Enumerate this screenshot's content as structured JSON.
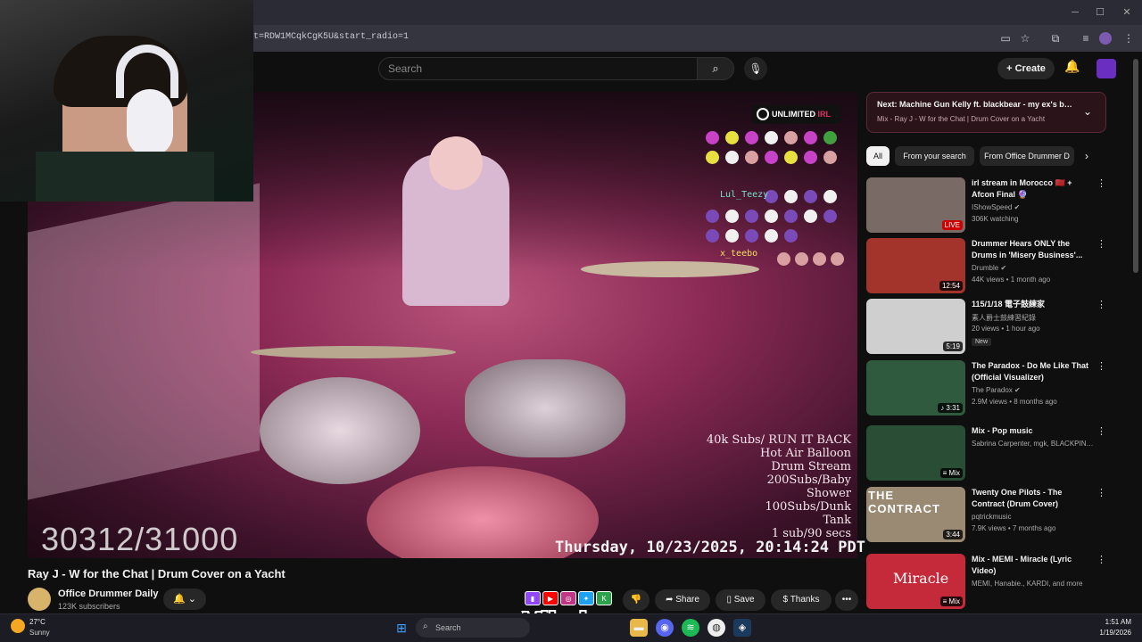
{
  "browser": {
    "url": "t=RDW1MCqkCgK5U&start_radio=1",
    "controls": {
      "minimize": "─",
      "maximize": "☐",
      "close": "✕"
    }
  },
  "header": {
    "search_placeholder": "Search",
    "create_label": "Create"
  },
  "video": {
    "counter": "30312/31000",
    "timestamp": "Thursday, 10/23/2025, 20:14:24 PDT",
    "brand": {
      "prefix": "UNLIMITED",
      "suffix": "IRL"
    },
    "goals": [
      "40k Subs/ RUN IT BACK",
      "Hot Air Balloon",
      "Drum Stream",
      "200Subs/Baby",
      "Shower",
      "100Subs/Dunk",
      "Tank",
      "1 sub/90 secs"
    ],
    "chat": [
      {
        "name": "Lul_Teezy"
      },
      {
        "name": "x_teebo"
      }
    ],
    "title": "Ray J - W for the Chat | Drum Cover on a Yacht",
    "channel": {
      "name": "Office Drummer Daily",
      "subs": "123K subscribers"
    },
    "actions": {
      "share": "Share",
      "save": "Save",
      "thanks": "Thanks",
      "more": "•••"
    }
  },
  "sidebar": {
    "next": {
      "line1": "Next: Machine Gun Kelly ft. blackbear - my ex's best...",
      "line2": "Mix - Ray J - W for the Chat | Drum Cover on a Yacht"
    },
    "chips": [
      "All",
      "From your search",
      "From Office Drummer D"
    ],
    "recommendations": [
      {
        "title": "irl stream in Morocco 🇲🇦 + Afcon Final 🔮",
        "channel": "IShowSpeed ✔",
        "meta": "306K watching",
        "badge": "LIVE",
        "thumb_bg": "#7a6a66"
      },
      {
        "title": "Drummer Hears ONLY the Drums in 'Misery Business'...",
        "channel": "Drumble ✔",
        "meta": "44K views • 1 month ago",
        "badge": "12:54",
        "thumb_bg": "#a2342c"
      },
      {
        "title": "115/1/18 電子鼓練家",
        "channel": "素人爵士鼓練習紀錄",
        "meta": "20 views • 1 hour ago",
        "badge": "5:19",
        "thumb_bg": "#cfcfcf",
        "new": "New"
      },
      {
        "title": "The Paradox - Do Me Like That (Official Visualizer)",
        "channel": "The Paradox ✔",
        "meta": "2.9M views • 8 months ago",
        "badge": "♪ 3:31",
        "thumb_bg": "#2f5a3d"
      },
      {
        "title": "Mix - Pop music",
        "channel": "Sabrina Carpenter, mgk, BLACKPINK, and more",
        "meta": "",
        "badge": "≡ Mix",
        "thumb_bg": "#2a4d36"
      },
      {
        "title": "Twenty One Pilots - The Contract (Drum Cover)",
        "channel": "pqtrickmusic",
        "meta": "7.9K views • 7 months ago",
        "badge": "3:44",
        "thumb_bg": "#9a8a74"
      },
      {
        "title": "Mix - MEMI - Miracle (Lyric Video)",
        "channel": "MEMI, Hanabie., KARDI, and more",
        "meta": "",
        "badge": "≡ Mix",
        "thumb_bg": "#c42a3a"
      }
    ],
    "contract_thumb_text": "THE CONTRACT",
    "miracle_thumb_text": "Miracle"
  },
  "taskbar": {
    "weather_temp": "27°C",
    "weather_desc": "Sunny",
    "search": "Search",
    "time": "1:51 AM",
    "date": "1/19/2026"
  },
  "overlay": {
    "vibzlo": "Vibzlo"
  }
}
